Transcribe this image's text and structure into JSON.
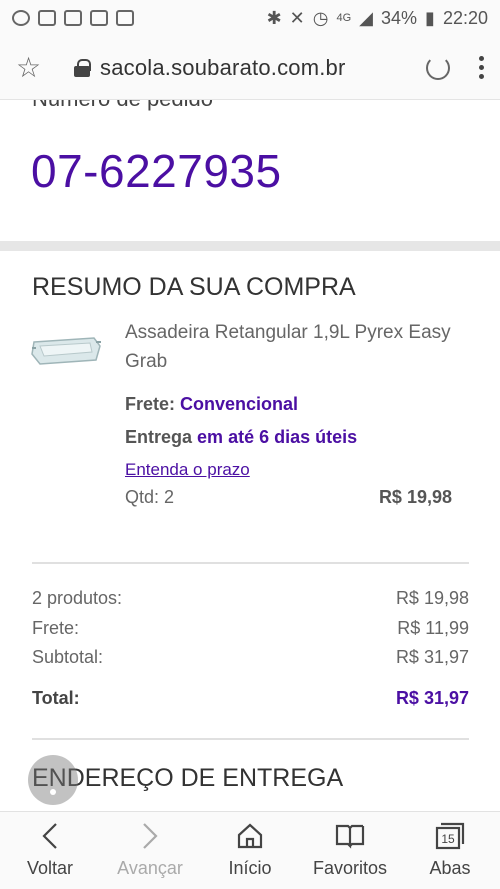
{
  "status_bar": {
    "battery": "34%",
    "time": "22:20",
    "network": "4G"
  },
  "browser": {
    "url": "sacola.soubarato.com.br"
  },
  "order": {
    "label": "Número de pedido",
    "number": "07-6227935"
  },
  "summary": {
    "title": "RESUMO DA SUA COMPRA",
    "product_name": "Assadeira Retangular 1,9L Pyrex Easy Grab",
    "freight_label": "Frete:",
    "freight_value": "Convencional",
    "delivery_label": "Entrega",
    "delivery_value": "em até 6 dias úteis",
    "prazo_link": "Entenda o prazo",
    "qty": "Qtd: 2",
    "item_price": "R$ 19,98"
  },
  "totals": [
    {
      "label": "2 produtos:",
      "value": "R$ 19,98"
    },
    {
      "label": "Frete:",
      "value": "R$ 11,99"
    },
    {
      "label": "Subtotal:",
      "value": "R$ 31,97"
    }
  ],
  "grand_total": {
    "label": "Total:",
    "value": "R$ 31,97"
  },
  "address": {
    "title": "ENDEREÇO DE ENTREGA"
  },
  "bottom_nav": [
    {
      "label": "Voltar",
      "icon": "chevron-left-icon",
      "enabled": true
    },
    {
      "label": "Avançar",
      "icon": "chevron-right-icon",
      "enabled": false
    },
    {
      "label": "Início",
      "icon": "home-icon",
      "enabled": true
    },
    {
      "label": "Favoritos",
      "icon": "book-icon",
      "enabled": true
    },
    {
      "label": "Abas",
      "icon": "tabs-icon",
      "tab_count": "15",
      "enabled": true
    }
  ],
  "colors": {
    "accent": "#4b0fa3",
    "text": "#333333",
    "muted": "#666666"
  }
}
